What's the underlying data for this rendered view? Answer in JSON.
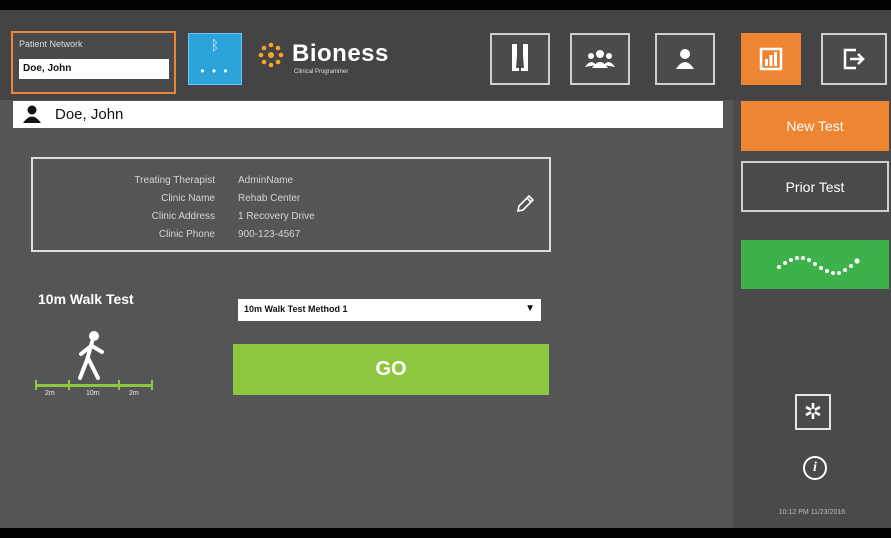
{
  "header": {
    "patient_network_label": "Patient Network",
    "patient_network_value": "Doe, John",
    "bluetooth_icon": "bluetooth-icon",
    "bluetooth_dots": "• • •",
    "brand_name": "Bioness",
    "brand_tagline": "Clinical Programmer",
    "nav_icons": [
      "legs-icon",
      "group-icon",
      "patient-icon",
      "reports-icon",
      "logout-icon"
    ]
  },
  "patient": {
    "name": "Doe, John"
  },
  "info": {
    "rows": [
      {
        "label": "Treating Therapist",
        "value": "AdminName"
      },
      {
        "label": "Clinic Name",
        "value": "Rehab Center"
      },
      {
        "label": "Clinic Address",
        "value": "1 Recovery Drive"
      },
      {
        "label": "Clinic Phone",
        "value": "900-123-4567"
      }
    ]
  },
  "test": {
    "title": "10m Walk Test",
    "method_selected": "10m Walk Test Method 1",
    "go_label": "GO",
    "distances": [
      "2m",
      "10m",
      "2m"
    ]
  },
  "sidebar": {
    "new_test_label": "New Test",
    "prior_test_label": "Prior Test",
    "timestamp": "10:12 PM 11/23/2016"
  },
  "colors": {
    "accent_orange": "#ee8533",
    "go_green": "#8dc63f",
    "trend_green": "#3db14a",
    "bluetooth_blue": "#2da3db"
  }
}
